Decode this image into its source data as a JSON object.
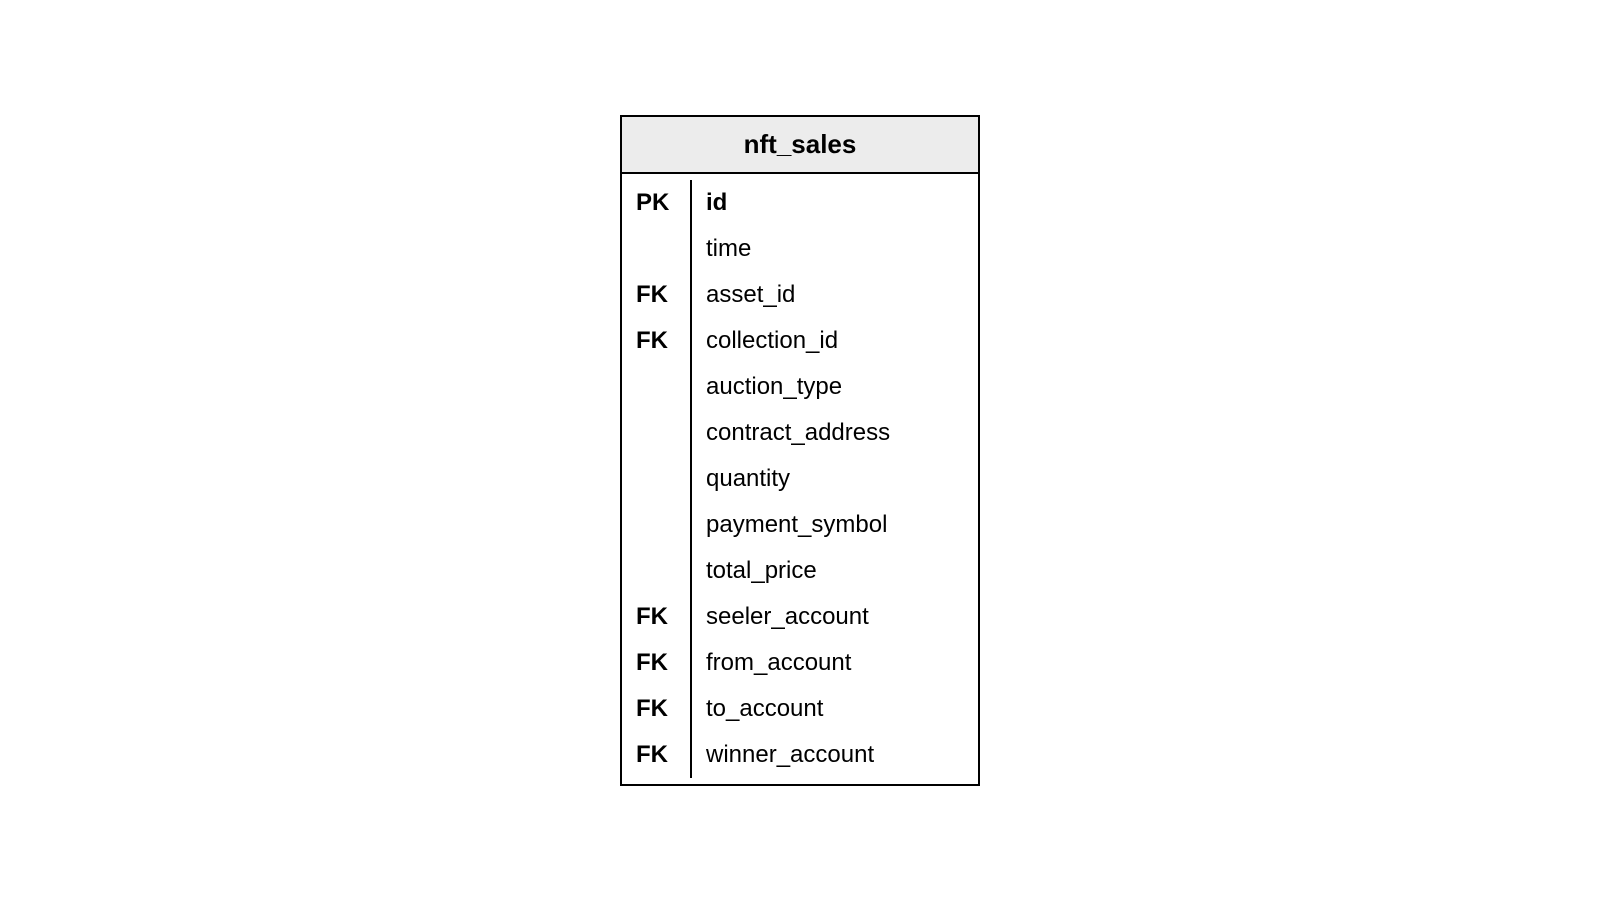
{
  "table": {
    "name": "nft_sales",
    "columns": [
      {
        "key": "PK",
        "name": "id",
        "bold": true
      },
      {
        "key": "",
        "name": "time",
        "bold": false
      },
      {
        "key": "FK",
        "name": "asset_id",
        "bold": false
      },
      {
        "key": "FK",
        "name": "collection_id",
        "bold": false
      },
      {
        "key": "",
        "name": "auction_type",
        "bold": false
      },
      {
        "key": "",
        "name": "contract_address",
        "bold": false
      },
      {
        "key": "",
        "name": "quantity",
        "bold": false
      },
      {
        "key": "",
        "name": "payment_symbol",
        "bold": false
      },
      {
        "key": "",
        "name": "total_price",
        "bold": false
      },
      {
        "key": "FK",
        "name": "seeler_account",
        "bold": false
      },
      {
        "key": "FK",
        "name": "from_account",
        "bold": false
      },
      {
        "key": "FK",
        "name": "to_account",
        "bold": false
      },
      {
        "key": "FK",
        "name": "winner_account",
        "bold": false
      }
    ]
  }
}
